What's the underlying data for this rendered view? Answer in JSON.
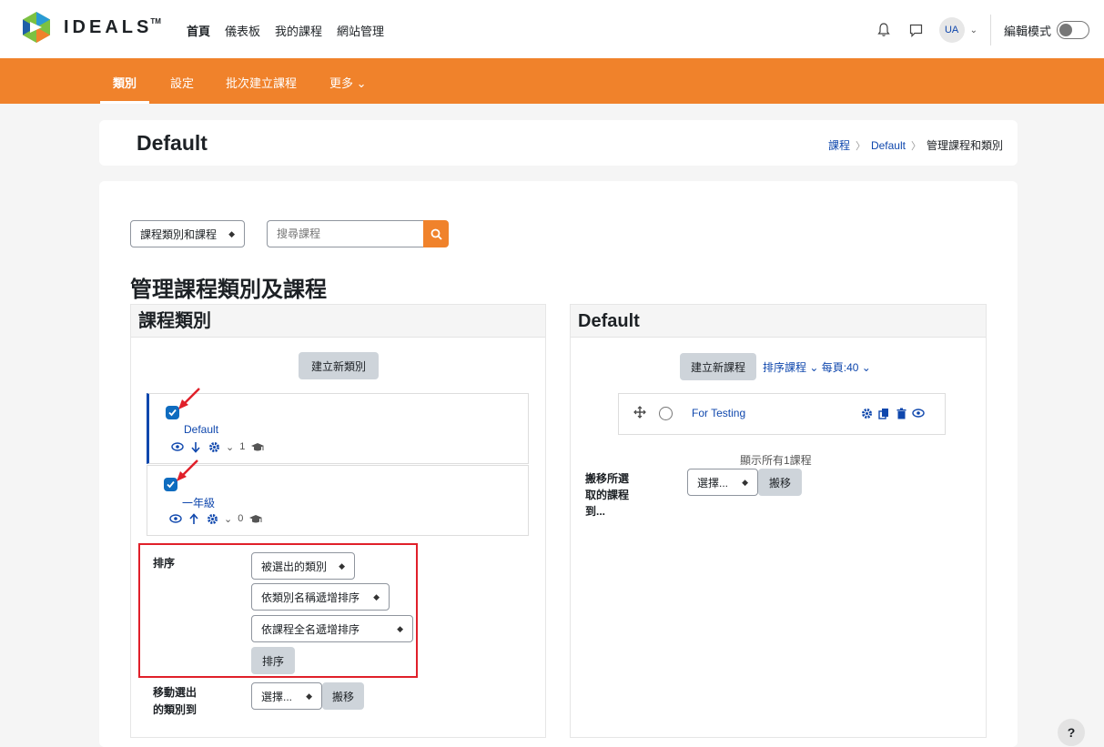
{
  "brand": {
    "name": "IDEALS",
    "tm": "TM"
  },
  "topnav": {
    "items": [
      "首頁",
      "儀表板",
      "我的課程",
      "網站管理"
    ],
    "avatar": "UA",
    "edit_mode_label": "編輯模式"
  },
  "subnav": {
    "items": [
      "類別",
      "設定",
      "批次建立課程",
      "更多 ⌄"
    ]
  },
  "header": {
    "title": "Default",
    "breadcrumb": [
      "課程",
      "Default",
      "管理課程和類別"
    ]
  },
  "search": {
    "scope": "課程類別和課程",
    "placeholder": "搜尋課程"
  },
  "page_heading": "管理課程類別及課程",
  "categories_panel": {
    "title": "課程類別",
    "new_button": "建立新類別",
    "items": [
      {
        "name": "Default",
        "count": "1"
      },
      {
        "name": "一年級",
        "count": "0"
      }
    ],
    "sort": {
      "label": "排序",
      "options": [
        "被選出的類別",
        "依類別名稱遞增排序",
        "依課程全名遞增排序"
      ],
      "button": "排序"
    },
    "move": {
      "label_line1": "移動選出",
      "label_line2": "的類別到",
      "select": "選擇...",
      "button": "搬移"
    }
  },
  "courses_panel": {
    "title": "Default",
    "new_button": "建立新課程",
    "sort_link": "排序課程",
    "per_page_link": "每頁:40",
    "course": "For Testing",
    "show_all": "顯示所有1課程",
    "move": {
      "label_line1": "搬移所選",
      "label_line2": "取的課程",
      "label_line3": "到...",
      "select": "選擇...",
      "button": "搬移"
    }
  },
  "help": "?",
  "colors": {
    "accent": "#f0822b",
    "link": "#0f47ad",
    "highlight": "#e0202a"
  }
}
